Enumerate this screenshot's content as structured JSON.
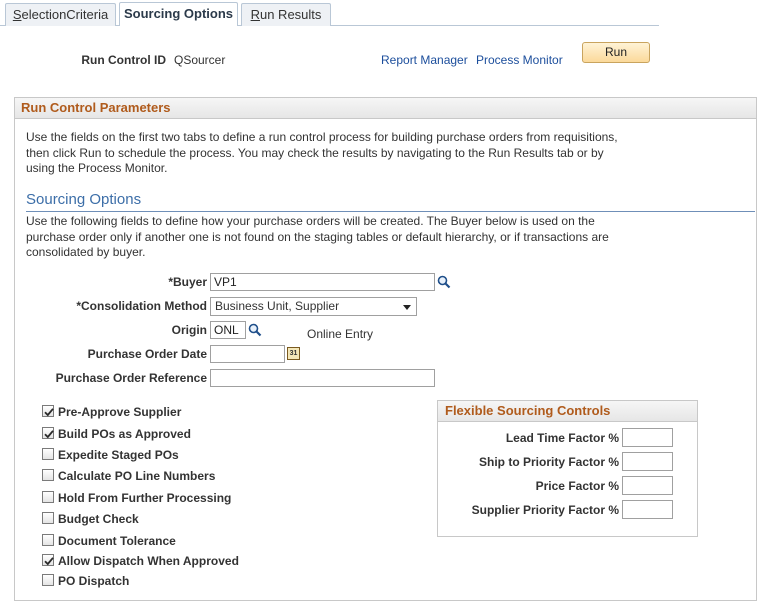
{
  "tabs": [
    {
      "label_u": "S",
      "label_rest": "electionCriteria"
    },
    {
      "label": "Sourcing Options"
    },
    {
      "label_u": "R",
      "label_rest": "un Results"
    }
  ],
  "header": {
    "run_control_label": "Run Control ID",
    "run_control_value": "QSourcer",
    "report_manager": "Report Manager",
    "process_monitor": "Process Monitor",
    "run_button": "Run"
  },
  "panel": {
    "title": "Run Control Parameters",
    "intro_lines": [
      "Use the fields on the first two tabs to define a run control process for building purchase orders from requisitions,",
      "then click Run to schedule the process. You may check the results by navigating to the Run Results tab or by",
      "using the Process Monitor."
    ],
    "section_title": "Sourcing Options",
    "section_lines": [
      "Use the following fields to define how your purchase orders will be created. The Buyer below is used on the",
      "purchase order only if another one is not found on the staging tables or default hierarchy, or if transactions are",
      "consolidated by buyer."
    ]
  },
  "fields": {
    "buyer_label": "*Buyer",
    "buyer_value": "VP1",
    "consolidation_label": "*Consolidation Method",
    "consolidation_value": "Business Unit, Supplier",
    "origin_label": "Origin",
    "origin_value": "ONL",
    "origin_desc": "Online Entry",
    "po_date_label": "Purchase Order Date",
    "po_date_value": "",
    "po_ref_label": "Purchase Order Reference",
    "po_ref_value": "",
    "calendar_day": "31"
  },
  "checkboxes": [
    {
      "label": "Pre-Approve Supplier",
      "checked": true
    },
    {
      "label": "Build POs as Approved",
      "checked": true
    },
    {
      "label": "Expedite Staged POs",
      "checked": false
    },
    {
      "label": "Calculate PO Line Numbers",
      "checked": false
    },
    {
      "label": "Hold From Further Processing",
      "checked": false
    },
    {
      "label": "Budget Check",
      "checked": false
    },
    {
      "label": "Document Tolerance",
      "checked": false
    },
    {
      "label": "Allow Dispatch When Approved",
      "checked": true
    },
    {
      "label": "PO Dispatch",
      "checked": false
    }
  ],
  "flexible": {
    "title": "Flexible Sourcing Controls",
    "fields": [
      {
        "label": "Lead Time Factor %",
        "value": ""
      },
      {
        "label": "Ship to Priority Factor %",
        "value": ""
      },
      {
        "label": "Price Factor %",
        "value": ""
      },
      {
        "label": "Supplier Priority Factor %",
        "value": ""
      }
    ]
  },
  "icons": {
    "lookup": "magnifier-icon",
    "calendar": "calendar-icon",
    "dropdown": "chevron-down-icon",
    "check": "checkmark-icon"
  }
}
